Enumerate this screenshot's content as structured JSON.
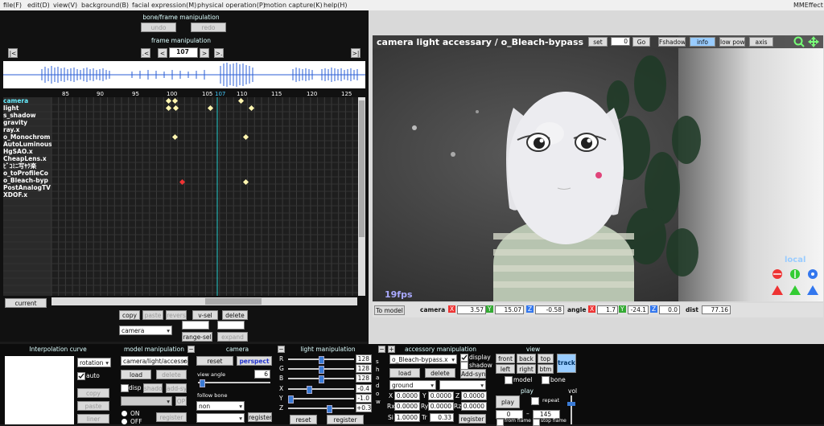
{
  "menu": {
    "items": [
      "file(F)",
      "edit(D)",
      "view(V)",
      "background(B)",
      "facial expression(M)",
      "physical operation(P)",
      "motion capture(K)",
      "help(H)"
    ],
    "app_name": "MMEffect"
  },
  "bone_frame": {
    "title": "bone/frame manipulation",
    "undo": "undo",
    "redo": "redo"
  },
  "frame_manip": {
    "title": "frame manipulation",
    "frame": "107",
    "first": "|<",
    "prev_key": ".<",
    "prev": "<",
    "next": ">",
    "next_key": ">.",
    "last": ">|"
  },
  "timeline": {
    "ticks": [
      "85",
      "90",
      "95",
      "100",
      "105",
      "107",
      "110",
      "115",
      "120",
      "125"
    ],
    "tracks": [
      "camera",
      "light",
      "s_shadow",
      "gravity",
      "ray.x",
      "o_Monochrom",
      "AutoLuminous",
      "HgSAO.x",
      "CheapLens.x",
      "ﾋﾞｺﾐﾆ写ﾔｸ楽",
      "o_toProfileCo",
      "o_Bleach-byp",
      "PostAnalogTV",
      "XDOF.x"
    ],
    "current_label": "current"
  },
  "timeline_ops": {
    "copy": "copy",
    "paste": "paste",
    "revers": "revers",
    "vsel": "v-sel",
    "delete": "delete",
    "target": "camera",
    "range_sel": "range-sel",
    "expand": "expand"
  },
  "viewport": {
    "title": "camera light accessary / o_Bleach-bypass",
    "set": "set",
    "set_value": "0",
    "go": "Go",
    "fshadow": "Fshadow",
    "info": "info",
    "low_pow": "low pow",
    "axis": "axis",
    "fps": "19fps",
    "local": "local",
    "to_model": "To model",
    "camera_label": "camera",
    "cam_x": "3.57",
    "cam_y": "15.07",
    "cam_z": "-0.58",
    "angle_label": "angle",
    "ang_x": "1.7",
    "ang_y": "-24.1",
    "ang_z": "0.0",
    "dist_label": "dist",
    "dist": "77.16",
    "x_tag": "X",
    "y_tag": "Y",
    "z_tag": "Z"
  },
  "interp": {
    "title": "Interpolation curve",
    "mode": "rotation",
    "auto": "auto",
    "copy": "copy",
    "paste": "paste",
    "liner": "liner"
  },
  "model": {
    "title": "model manipulation",
    "model": "camera/light/accesso",
    "load": "load",
    "delete": "delete",
    "disp": "disp",
    "shadow": "shadow",
    "add_syn": "add-syn",
    "op": "OP",
    "on": "ON",
    "off": "OFF",
    "register": "register"
  },
  "camera": {
    "title": "camera",
    "reset": "reset",
    "perspect": "perspect",
    "view_angle_label": "view angle",
    "view_angle": "6",
    "follow_bone": "follow bone",
    "follow": "non",
    "register": "register"
  },
  "light": {
    "title": "light manipulation",
    "r_label": "R",
    "g_label": "G",
    "b_label": "B",
    "x_label": "X",
    "y_label": "Y",
    "z_label": "Z",
    "r": "128",
    "g": "128",
    "b": "128",
    "x": "-0.4",
    "y": "-1.0",
    "z": "+0.3",
    "reset": "reset",
    "register": "register",
    "shadow": "shadow"
  },
  "accessory": {
    "title": "accessory manipulation",
    "name": "o_Bleach-bypass.x",
    "display": "display",
    "shadow": "shadow",
    "load": "load",
    "delete": "delete",
    "add_syn": "Add-syn",
    "parent": "ground",
    "x_label": "X",
    "y_label": "Y",
    "z_label": "Z",
    "rx_label": "Rx",
    "ry_label": "Ry",
    "rz_label": "Rz",
    "si_label": "Si",
    "tr_label": "Tr",
    "x": "0.0000",
    "y": "0.0000",
    "z": "0.0000",
    "rx": "0.0000",
    "ry": "0.0000",
    "rz": "0.0000",
    "si": "1.0000",
    "tr": "0.33",
    "register": "register"
  },
  "view": {
    "title": "view",
    "front": "front",
    "back": "back",
    "top": "top",
    "left": "left",
    "right": "right",
    "btm": "btm",
    "track": "track",
    "model": "model",
    "bone": "bone"
  },
  "play": {
    "title": "play",
    "play": "play",
    "repeat": "repeat",
    "from_val": "0",
    "to_val": "145",
    "from_frame": "from flame",
    "stop_frame": "stop flame",
    "vol": "vol"
  }
}
